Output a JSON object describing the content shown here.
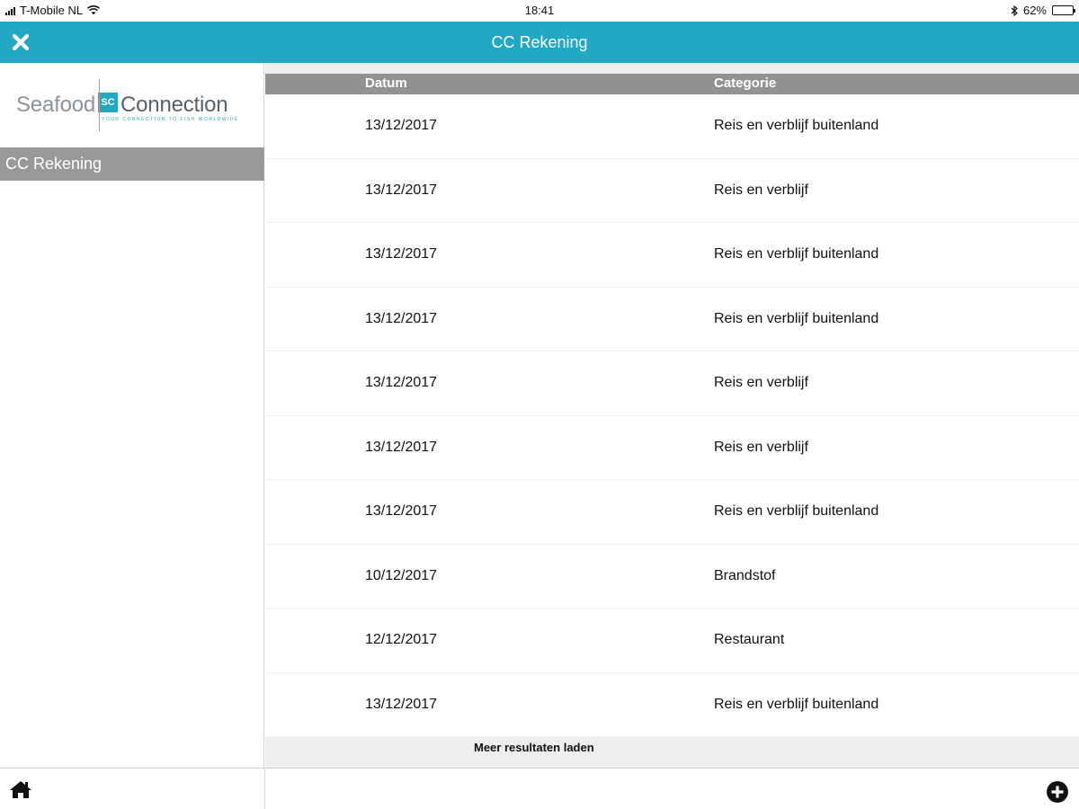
{
  "status_bar": {
    "carrier": "T-Mobile NL",
    "time": "18:41",
    "battery": "62%",
    "battery_level": 0.62,
    "icons": [
      "signal-icon",
      "wifi-icon",
      "bluetooth-icon",
      "battery-icon"
    ]
  },
  "navbar": {
    "title": "CC Rekening",
    "close_icon": "close-icon"
  },
  "sidebar": {
    "logo": {
      "word1": "Seafood",
      "mark": "SC",
      "word2": "Connection",
      "tagline": "YOUR CONNECTION TO FISH WORLDWIDE"
    },
    "items": [
      {
        "label": "CC Rekening",
        "selected": true
      }
    ]
  },
  "table": {
    "columns": [
      "Datum",
      "Categorie"
    ],
    "rows": [
      {
        "datum": "13/12/2017",
        "categorie": "Reis en verblijf buitenland"
      },
      {
        "datum": "13/12/2017",
        "categorie": "Reis en verblijf"
      },
      {
        "datum": "13/12/2017",
        "categorie": "Reis en verblijf buitenland"
      },
      {
        "datum": "13/12/2017",
        "categorie": "Reis en verblijf buitenland"
      },
      {
        "datum": "13/12/2017",
        "categorie": "Reis en verblijf"
      },
      {
        "datum": "13/12/2017",
        "categorie": "Reis en verblijf"
      },
      {
        "datum": "13/12/2017",
        "categorie": "Reis en verblijf buitenland"
      },
      {
        "datum": "10/12/2017",
        "categorie": "Brandstof"
      },
      {
        "datum": "12/12/2017",
        "categorie": "Restaurant"
      },
      {
        "datum": "13/12/2017",
        "categorie": "Reis en verblijf buitenland"
      }
    ],
    "load_more": "Meer resultaten laden"
  },
  "bottom_toolbar": {
    "left_icon": "home-icon",
    "right_icon": "add-circle-icon"
  },
  "colors": {
    "accent": "#21a9c4",
    "header_gray": "#929292",
    "selected_gray": "#999999"
  }
}
